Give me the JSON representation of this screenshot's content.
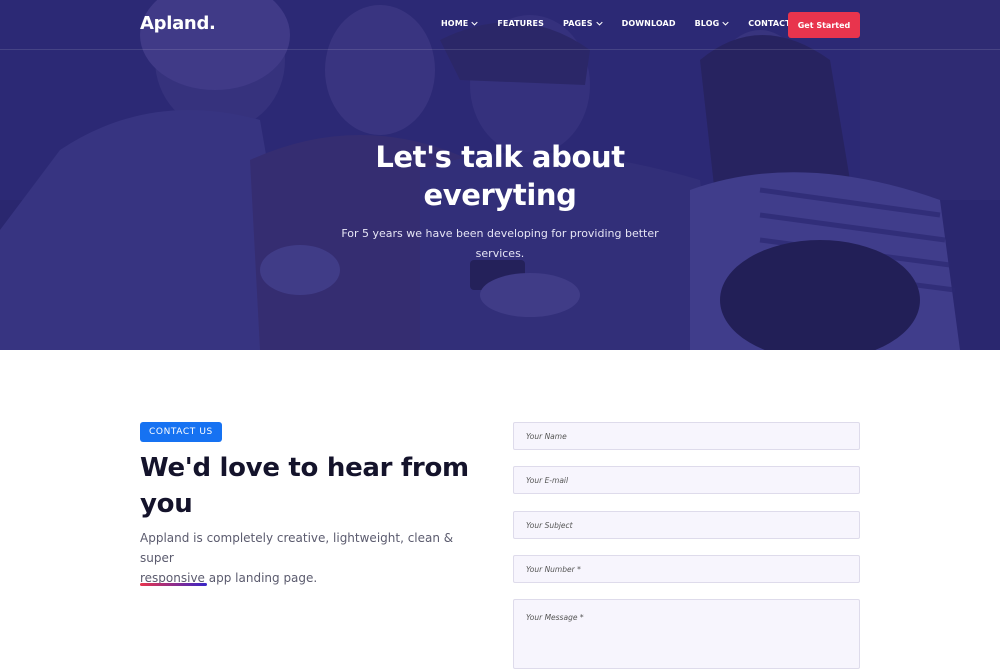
{
  "header": {
    "logo": "Apland.",
    "nav": [
      {
        "label": "HOME",
        "dropdown": true
      },
      {
        "label": "FEATURES",
        "dropdown": false
      },
      {
        "label": "PAGES",
        "dropdown": true
      },
      {
        "label": "DOWNLOAD",
        "dropdown": false
      },
      {
        "label": "BLOG",
        "dropdown": true
      },
      {
        "label": "CONTACT",
        "dropdown": false
      }
    ],
    "cta": "Get Started"
  },
  "hero": {
    "title_line1": "Let's talk about",
    "title_line2": "everyting",
    "subtitle_line1": "For 5 years we have been developing for providing better",
    "subtitle_line2": "services."
  },
  "contact": {
    "badge": "CONTACT US",
    "title_line1": "We'd love to hear from",
    "title_line2": "you",
    "desc_line1": "Appland is completely creative, lightweight, clean & super",
    "desc_line2": "responsive app landing page."
  },
  "form": {
    "name_placeholder": "Your Name",
    "email_placeholder": "Your E-mail",
    "subject_placeholder": "Your Subject",
    "number_placeholder": "Your Number *",
    "message_placeholder": "Your Message *"
  },
  "colors": {
    "hero_overlay": "#2e2a78",
    "cta_red": "#e8344d",
    "badge_blue": "#1672f2",
    "field_bg": "#f7f5fd"
  }
}
